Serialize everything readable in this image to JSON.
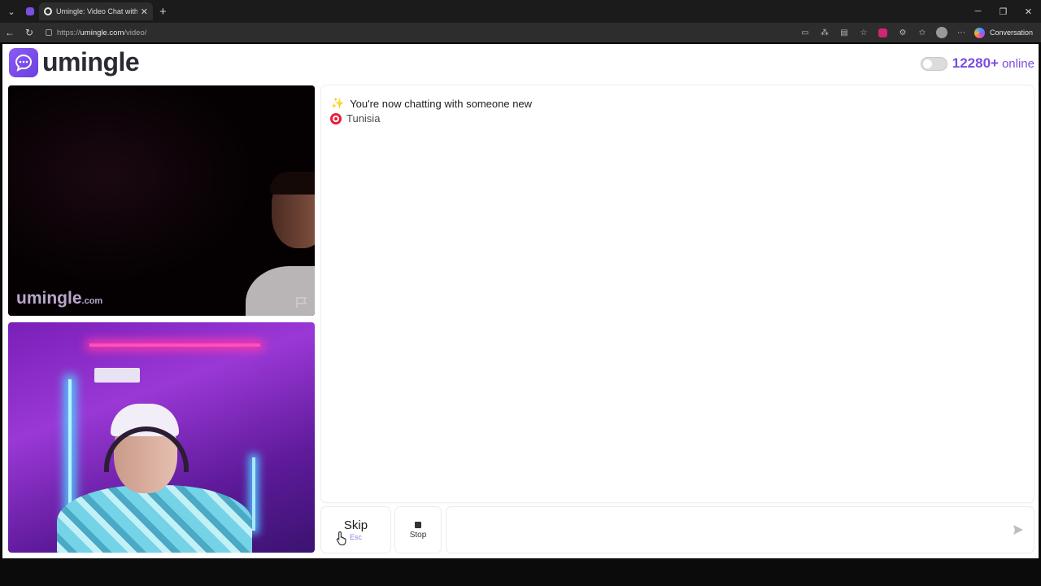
{
  "browser": {
    "tabs": [
      {
        "title": "",
        "icon": "umingle-favicon"
      },
      {
        "title": "Umingle: Video Chat with Stra",
        "icon": "globe-icon",
        "active": true
      }
    ],
    "url_prefix": "https://",
    "url_host": "umingle.com",
    "url_path": "/video/",
    "conversation_label": "Conversation"
  },
  "site": {
    "logo_text": "umingle",
    "online_count": "12280+",
    "online_label": "online",
    "watermark_main": "umingle",
    "watermark_suffix": ".com"
  },
  "chat": {
    "status_message": "You're now chatting with someone new",
    "country": "Tunisia"
  },
  "controls": {
    "skip_label": "Skip",
    "skip_key": "Esc",
    "stop_label": "Stop",
    "input_placeholder": ""
  },
  "colors": {
    "brand": "#7a4de0",
    "browser_bg": "#1b1b1b"
  }
}
